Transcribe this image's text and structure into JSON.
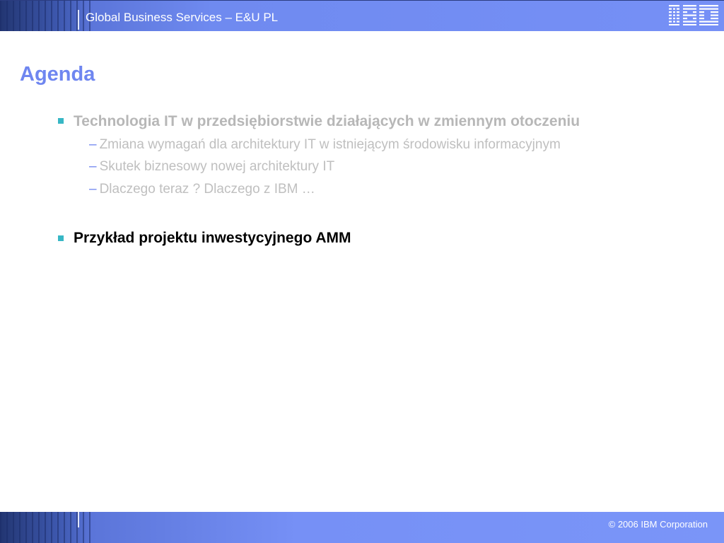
{
  "header": {
    "title": "Global Business Services – E&U PL",
    "logo": "IBM"
  },
  "slide": {
    "heading": "Agenda",
    "items": [
      {
        "label": "Technologia IT w przedsiębiorstwie działających w zmiennym otoczeniu",
        "state": "dimmed",
        "subitems": [
          "Zmiana wymagań dla architektury IT w istniejącym środowisku informacyjnym",
          "Skutek biznesowy nowej architektury IT",
          "Dlaczego teraz ? Dlaczego z IBM …"
        ]
      },
      {
        "label": "Przykład projektu inwestycyjnego AMM",
        "state": "active",
        "subitems": []
      }
    ],
    "dash": "–"
  },
  "footer": {
    "copyright": "© 2006 IBM Corporation"
  },
  "colors": {
    "accent": "#6f86f0",
    "bullet": "#37b7c5",
    "dimmed_text": "#b7b7b7",
    "band": "#7690f6"
  }
}
